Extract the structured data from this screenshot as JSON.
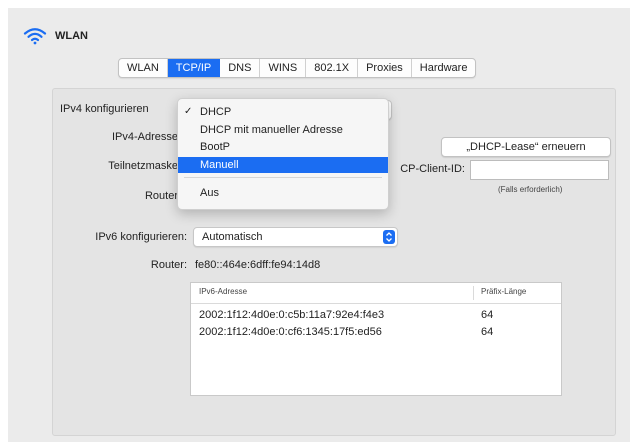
{
  "header": {
    "title": "WLAN",
    "icon": "wifi-icon"
  },
  "tabs": [
    {
      "label": "WLAN"
    },
    {
      "label": "TCP/IP"
    },
    {
      "label": "DNS"
    },
    {
      "label": "WINS"
    },
    {
      "label": "802.1X"
    },
    {
      "label": "Proxies"
    },
    {
      "label": "Hardware"
    }
  ],
  "active_tab": "TCP/IP",
  "ipv4": {
    "configure_label": "IPv4 konfigurieren",
    "address_label": "IPv4-Adresse",
    "subnet_label": "Teilnetzmaske",
    "router_label": "Router",
    "renew_button": "„DHCP-Lease“ erneuern",
    "client_id_label": "CP-Client-ID:",
    "client_id_value": "",
    "client_id_hint": "(Falls erforderlich)"
  },
  "ipv4_menu": {
    "items": [
      {
        "label": "DHCP",
        "checked": true
      },
      {
        "label": "DHCP mit manueller Adresse"
      },
      {
        "label": "BootP"
      },
      {
        "label": "Manuell",
        "highlighted": true
      },
      {
        "label": "Aus"
      }
    ]
  },
  "ipv6": {
    "configure_label": "IPv6 konfigurieren:",
    "configure_value": "Automatisch",
    "router_label": "Router:",
    "router_value": "fe80::464e:6dff:fe94:14d8"
  },
  "ipv6_table": {
    "columns": [
      "IPv6-Adresse",
      "Präfix-Länge"
    ],
    "rows": [
      {
        "address": "2002:1f12:4d0e:0:c5b:11a7:92e4:f4e3",
        "prefix": "64"
      },
      {
        "address": "2002:1f12:4d0e:0:cf6:1345:17f5:ed56",
        "prefix": "64"
      }
    ]
  },
  "colors": {
    "accent": "#1b6df2",
    "panel": "#ebebeb",
    "content": "#e4e4e4"
  }
}
